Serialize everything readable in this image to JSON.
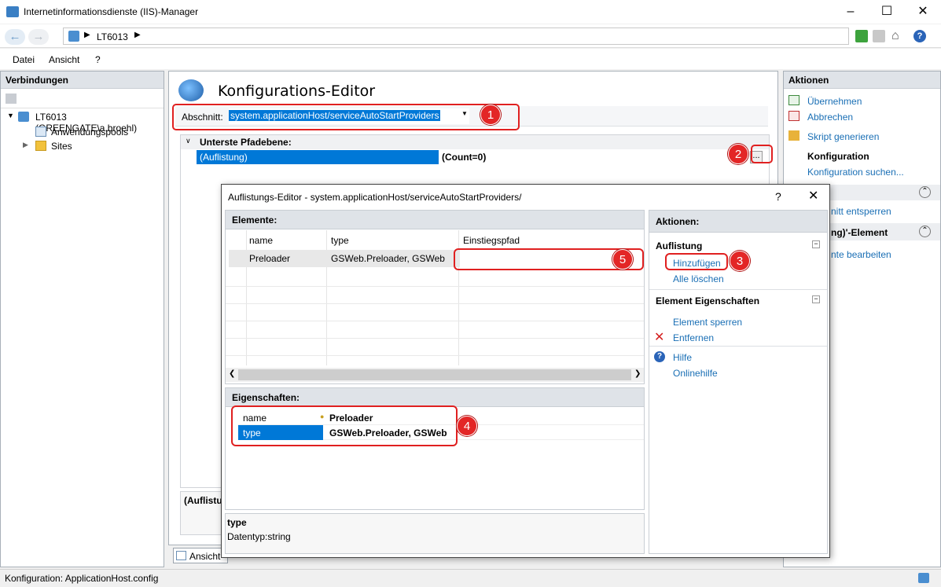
{
  "window": {
    "title": "Internetinformationsdienste (IIS)-Manager"
  },
  "address": {
    "crumb": "LT6013"
  },
  "menu": {
    "datei": "Datei",
    "ansicht": "Ansicht",
    "help": "?"
  },
  "left": {
    "header": "Verbindungen",
    "root": "LT6013 (GREENGATE\\a.broehl)",
    "app_pools": "Anwendungspools",
    "sites": "Sites"
  },
  "center": {
    "title": "Konfigurations-Editor",
    "section_label": "Abschnitt:",
    "section_value": "system.applicationHost/serviceAutoStartProviders",
    "group": "Unterste Pfadebene:",
    "row_name": "(Auflistung)",
    "row_value": "(Count=0)",
    "bottom_label": "(Auflistu",
    "tab_view": "Ansicht"
  },
  "right": {
    "header": "Aktionen",
    "apply": "Übernehmen",
    "cancel": "Abbrechen",
    "script": "Skript generieren",
    "config_head": "Konfiguration",
    "config_search": "Konfiguration suchen...",
    "unlock": "nitt entsperren",
    "element_head": "ng)'-Element",
    "edit_items": "nte bearbeiten"
  },
  "dialog": {
    "title": "Auflistungs-Editor - system.applicationHost/serviceAutoStartProviders/",
    "help": "?",
    "elements_header": "Elemente:",
    "columns": [
      "name",
      "type",
      "Einstiegspfad"
    ],
    "rows": [
      {
        "name": "Preloader",
        "type": "GSWeb.Preloader, GSWeb",
        "path": ""
      }
    ],
    "props_header": "Eigenschaften:",
    "props": [
      {
        "key": "name",
        "value": "Preloader"
      },
      {
        "key": "type",
        "value": "GSWeb.Preloader, GSWeb"
      }
    ],
    "desc_title": "type",
    "desc_text": "Datentyp:string",
    "actions_header": "Aktionen:",
    "group1": "Auflistung",
    "add": "Hinzufügen",
    "clear": "Alle löschen",
    "group2": "Element Eigenschaften",
    "lock": "Element sperren",
    "remove": "Entfernen",
    "help_link": "Hilfe",
    "online_help": "Onlinehilfe"
  },
  "badges": [
    "1",
    "2",
    "3",
    "4",
    "5"
  ],
  "status": {
    "text": "Konfiguration: ApplicationHost.config"
  },
  "colors": {
    "accent": "#0078d7",
    "annotation": "#e02020",
    "link": "#1a6fb5"
  }
}
